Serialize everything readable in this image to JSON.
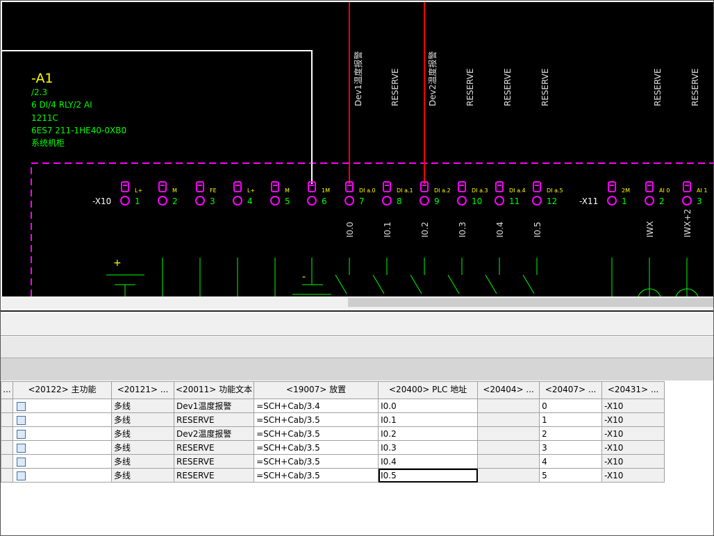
{
  "device": {
    "tag": "-A1",
    "page_ref": "/2.3",
    "desc": "6 DI/4 RLY/2 AI",
    "model": "1211C",
    "order_no": "6ES7 211-1HE40-0XB0",
    "location": "系统机柜"
  },
  "terminal_strips": [
    {
      "name": "-X10"
    },
    {
      "name": "-X11"
    }
  ],
  "pins": [
    {
      "label": "L+",
      "num": "1"
    },
    {
      "label": "M",
      "num": "2"
    },
    {
      "label": "FE",
      "num": "3"
    },
    {
      "label": "L+",
      "num": "4"
    },
    {
      "label": "M",
      "num": "5"
    },
    {
      "label": "1M",
      "num": "6"
    },
    {
      "label": "DI a.0",
      "num": "7"
    },
    {
      "label": "DI a.1",
      "num": "8"
    },
    {
      "label": "DI a.2",
      "num": "9"
    },
    {
      "label": "DI a.3",
      "num": "10"
    },
    {
      "label": "DI a.4",
      "num": "11"
    },
    {
      "label": "DI a.5",
      "num": "12"
    },
    {
      "label": "2M",
      "num": "1"
    },
    {
      "label": "AI 0",
      "num": "2"
    },
    {
      "label": "AI 1",
      "num": "3"
    }
  ],
  "wire_labels": [
    "Dev1温度报警",
    "RESERVE",
    "Dev2温度报警",
    "RESERVE",
    "RESERVE",
    "RESERVE",
    "RESERVE",
    "RESERVE"
  ],
  "addresses": [
    "I0.0",
    "I0.1",
    "I0.2",
    "I0.3",
    "I0.4",
    "I0.5",
    "IWX",
    "IWX+2"
  ],
  "symbols": {
    "plus": "+",
    "minus": "-"
  },
  "table": {
    "columns": [
      "<20122> 主功能",
      "<20121> ...",
      "<20011> 功能文本",
      "<19007> 放置",
      "<20400> PLC 地址",
      "<20404> ...",
      "<20407> ...",
      "<20431> ..."
    ],
    "rows": [
      {
        "type": "多线",
        "func_text": "Dev1温度报警",
        "placement": "=SCH+Cab/3.4",
        "plc_addr": "I0.0",
        "c6": "",
        "c7": "0",
        "c8": "-X10"
      },
      {
        "type": "多线",
        "func_text": "RESERVE",
        "placement": "=SCH+Cab/3.5",
        "plc_addr": "I0.1",
        "c6": "",
        "c7": "1",
        "c8": "-X10"
      },
      {
        "type": "多线",
        "func_text": "Dev2温度报警",
        "placement": "=SCH+Cab/3.5",
        "plc_addr": "I0.2",
        "c6": "",
        "c7": "2",
        "c8": "-X10"
      },
      {
        "type": "多线",
        "func_text": "RESERVE",
        "placement": "=SCH+Cab/3.5",
        "plc_addr": "I0.3",
        "c6": "",
        "c7": "3",
        "c8": "-X10"
      },
      {
        "type": "多线",
        "func_text": "RESERVE",
        "placement": "=SCH+Cab/3.5",
        "plc_addr": "I0.4",
        "c6": "",
        "c7": "4",
        "c8": "-X10"
      },
      {
        "type": "多线",
        "func_text": "RESERVE",
        "placement": "=SCH+Cab/3.5",
        "plc_addr": "I0.5",
        "c6": "",
        "c7": "5",
        "c8": "-X10"
      }
    ]
  },
  "colors": {
    "background": "#000000",
    "device_text": "#00ff00",
    "device_tag": "#ffff00",
    "plc_box": "#ff00ff",
    "wire_red": "#ff0000",
    "wire_white": "#ffffff",
    "wire_green": "#00ff00",
    "pin_label": "#ffff00"
  }
}
